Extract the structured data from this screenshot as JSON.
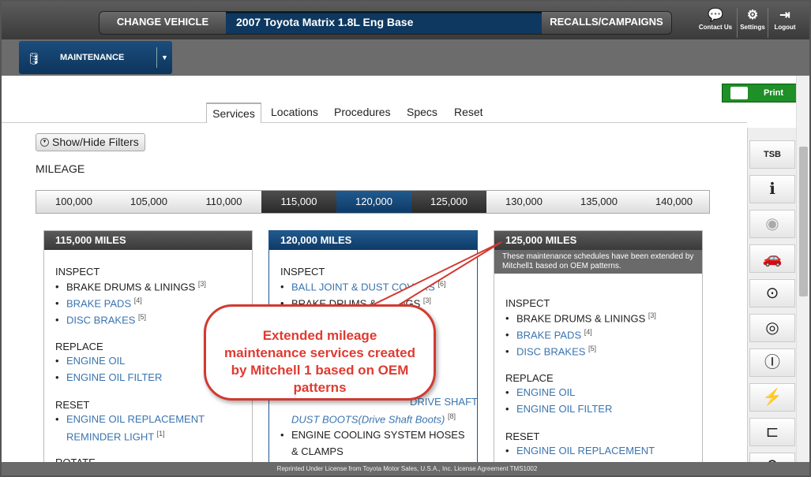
{
  "header": {
    "change_vehicle": "CHANGE VEHICLE",
    "vehicle": "2007 Toyota Matrix 1.8L Eng Base",
    "recalls": "RECALLS/CAMPAIGNS",
    "contact": "Contact Us",
    "settings": "Settings",
    "logout": "Logout"
  },
  "module": {
    "label": "MAINTENANCE"
  },
  "print_label": "Print",
  "tabs": [
    "Services",
    "Locations",
    "Procedures",
    "Specs",
    "Reset"
  ],
  "filters_label": "Show/Hide Filters",
  "mileage_title": "MILEAGE",
  "mileages": [
    "100,000",
    "105,000",
    "110,000",
    "115,000",
    "120,000",
    "125,000",
    "130,000",
    "135,000",
    "140,000"
  ],
  "cards": [
    {
      "title": "115,000 MILES",
      "groups": [
        {
          "name": "INSPECT",
          "items": [
            {
              "text": "BRAKE DRUMS & LININGS",
              "ref": "[3]",
              "link": false
            },
            {
              "text": "BRAKE PADS",
              "ref": "[4]",
              "link": true
            },
            {
              "text": "DISC BRAKES",
              "ref": "[5]",
              "link": true
            }
          ]
        },
        {
          "name": "REPLACE",
          "items": [
            {
              "text": "ENGINE OIL",
              "ref": "",
              "link": true
            },
            {
              "text": "ENGINE OIL FILTER",
              "ref": "",
              "link": true
            }
          ]
        },
        {
          "name": "RESET",
          "items": [
            {
              "text": "ENGINE OIL REPLACEMENT",
              "ref": "",
              "link": true
            },
            {
              "text": "REMINDER LIGHT",
              "ref": "[1]",
              "link": true
            }
          ]
        },
        {
          "name": "ROTATE",
          "items": []
        }
      ]
    },
    {
      "title": "120,000 MILES",
      "groups": [
        {
          "name": "INSPECT",
          "items": [
            {
              "text": "BALL JOINT & DUST COVERS",
              "ref": "[6]",
              "link": true
            },
            {
              "text": "BRAKE DRUMS & LININGS",
              "ref": "[3]",
              "link": false
            },
            {
              "text": "DRIVE SHAFT",
              "ref": "",
              "link": true
            },
            {
              "text": "DUST BOOTS(Drive Shaft Boots)",
              "ref": "[8]",
              "link": true
            },
            {
              "text": "ENGINE COOLING SYSTEM HOSES",
              "ref": "",
              "link": false
            },
            {
              "text": "& CLAMPS",
              "ref": "",
              "link": false
            }
          ]
        }
      ]
    },
    {
      "title": "125,000 MILES",
      "note": "These maintenance schedules have been extended by Mitchell1 based on OEM patterns.",
      "groups": [
        {
          "name": "INSPECT",
          "items": [
            {
              "text": "BRAKE DRUMS & LININGS",
              "ref": "[3]",
              "link": false
            },
            {
              "text": "BRAKE PADS",
              "ref": "[4]",
              "link": true
            },
            {
              "text": "DISC BRAKES",
              "ref": "[5]",
              "link": true
            }
          ]
        },
        {
          "name": "REPLACE",
          "items": [
            {
              "text": "ENGINE OIL",
              "ref": "",
              "link": true
            },
            {
              "text": "ENGINE OIL FILTER",
              "ref": "",
              "link": true
            }
          ]
        },
        {
          "name": "RESET",
          "items": [
            {
              "text": "ENGINE OIL REPLACEMENT",
              "ref": "",
              "link": true
            }
          ]
        }
      ]
    }
  ],
  "callout": "Extended mileage maintenance services created by Mitchell 1 based on OEM patterns",
  "sidebar_icons": [
    "tsb-icon",
    "info-doc-icon",
    "sensor-car-icon",
    "car-wash-icon",
    "tire-pressure-icon",
    "wheel-icon",
    "brake-reset-icon",
    "battery-engine-icon",
    "connector-icon",
    "search-icon"
  ],
  "footer": "Reprinted Under License from Toyota Motor Sales, U.S.A., Inc. License Agreement TMS1002",
  "colors": {
    "accent_blue": "#0e3a66",
    "link": "#3a74b0",
    "print_green": "#1f8f27",
    "callout_red": "#e03a30"
  }
}
